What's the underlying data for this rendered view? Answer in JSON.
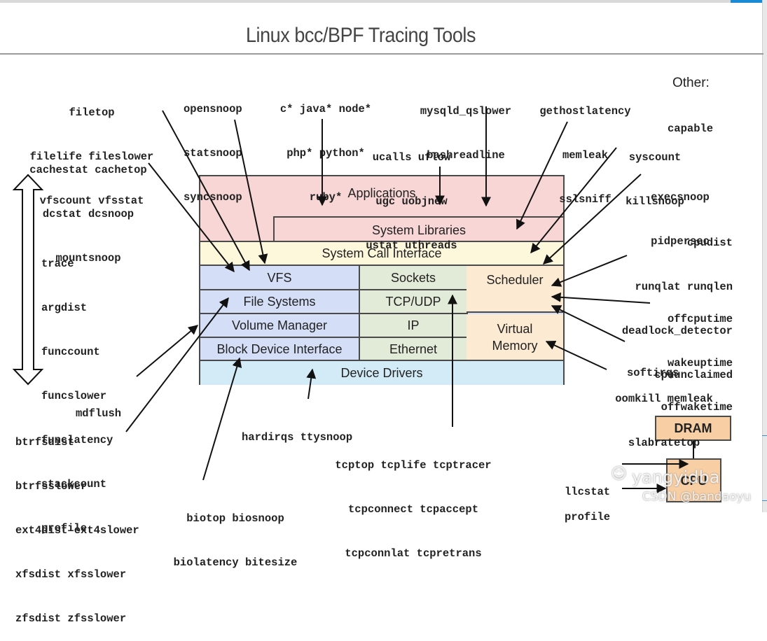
{
  "title": "Linux bcc/BPF Tracing Tools",
  "colors": {
    "applications": "#f8d6d6",
    "syscall": "#fdf8dc",
    "storage": "#d4dff7",
    "network": "#e2ebd8",
    "cpu_mem": "#fcead3",
    "drivers": "#d3eaf7",
    "hardware": "#f8cfa4",
    "outline": "#4a4a4a"
  },
  "layers": {
    "applications": "Applications",
    "system_libraries": "System Libraries",
    "system_call_interface": "System Call Interface",
    "vfs": "VFS",
    "file_systems": "File Systems",
    "volume_manager": "Volume Manager",
    "block_device_interface": "Block Device Interface",
    "sockets": "Sockets",
    "tcp_udp": "TCP/UDP",
    "ip": "IP",
    "ethernet": "Ethernet",
    "scheduler": "Scheduler",
    "virtual_memory_line1": "Virtual",
    "virtual_memory_line2": "Memory",
    "device_drivers": "Device Drivers",
    "dram": "DRAM",
    "cpu": "CPU"
  },
  "tool_groups": {
    "file": [
      "filetop",
      "filelife fileslower",
      "vfscount vfsstat"
    ],
    "cache": [
      "cachestat cachetop",
      "dcstat dcsnoop",
      "mountsnoop"
    ],
    "snoop": [
      "opensnoop",
      "statsnoop",
      "syncsnoop"
    ],
    "lang": [
      "c* java* node*",
      "php* python*",
      "ruby*"
    ],
    "uprobe": [
      "ucalls uflow",
      "ugc uobjnew",
      "ustat uthreads"
    ],
    "mysql": [
      "mysqld_qslower",
      "bashreadline"
    ],
    "libs": [
      "gethostlatency",
      "memleak",
      "sslsniff"
    ],
    "other_label": "Other:",
    "other": [
      "capable"
    ],
    "syscount": [
      "syscount",
      "killsnoop"
    ],
    "exec": [
      "execsnoop",
      "pidpersec"
    ],
    "multi": [
      "trace",
      "argdist",
      "funccount",
      "funcslower",
      "funclatency",
      "stackcount",
      "profile"
    ],
    "sched": [
      "cpudist",
      "runqlat runqlen",
      "deadlock_detector",
      "cpuunclaimed"
    ],
    "offcpu": [
      "offcputime",
      "wakeuptime",
      "offwaketime"
    ],
    "softirqs": [
      "softirqs"
    ],
    "vm": [
      "oomkill memleak",
      "slabratetop"
    ],
    "mdflush": [
      "mdflush"
    ],
    "fs": [
      "btrfsdist",
      "btrfsslower",
      "ext4dist ext4slower",
      "xfsdist xfsslower",
      "zfsdist zfsslower"
    ],
    "bio": [
      "biotop biosnoop",
      "biolatency bitesize"
    ],
    "irq": [
      "hardirqs ttysnoop"
    ],
    "tcp": [
      "tcptop tcplife tcptracer",
      "tcpconnect tcpaccept",
      "tcpconnlat tcpretrans"
    ],
    "llcstat": [
      "llcstat"
    ],
    "profile_cpu": [
      "profile"
    ]
  },
  "watermark": {
    "line1": "yangyidba",
    "line2": "CSDN @bandaoyu"
  }
}
